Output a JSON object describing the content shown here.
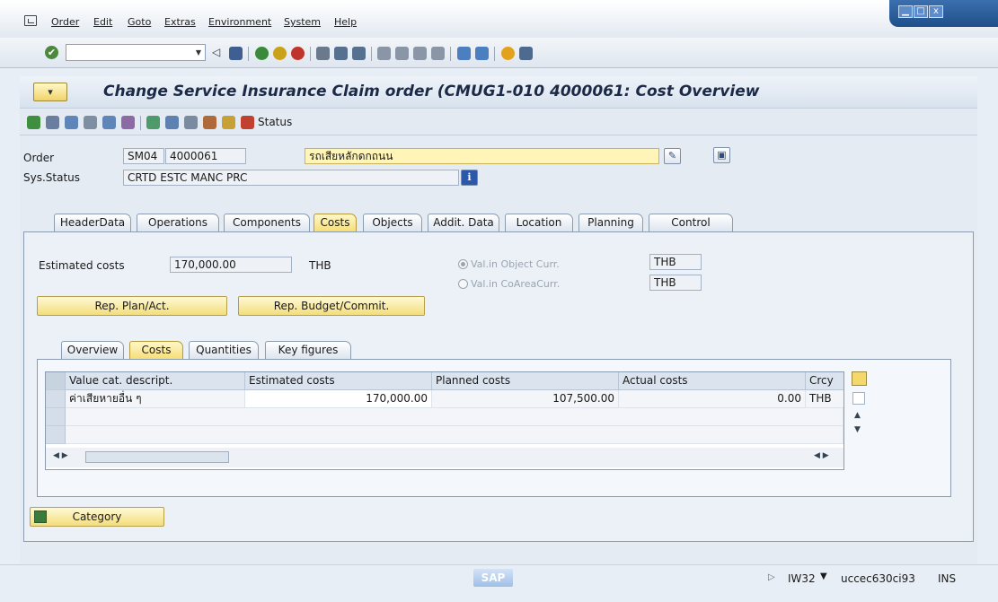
{
  "menu": {
    "items": [
      "Order",
      "Edit",
      "Goto",
      "Extras",
      "Environment",
      "System",
      "Help"
    ]
  },
  "window_controls": {
    "min": "▁",
    "max": "□",
    "close": "x"
  },
  "toolbar": {
    "command_value": ""
  },
  "title": "Change Service Insurance Claim order (CMUG1-010 4000061: Cost Overview",
  "app_toolbar": {
    "status_label": "Status"
  },
  "header": {
    "order_label": "Order",
    "order_type": "SM04",
    "order_number": "4000061",
    "order_description": "รถเสียหลักดกถนน",
    "sys_status_label": "Sys.Status",
    "sys_status_value": "CRTD ESTC MANC PRC"
  },
  "tabs": [
    "HeaderData",
    "Operations",
    "Components",
    "Costs",
    "Objects",
    "Addit. Data",
    "Location",
    "Planning",
    "Control"
  ],
  "active_tab": "Costs",
  "costs": {
    "estimated_label": "Estimated costs",
    "estimated_value": "170,000.00",
    "estimated_currency": "THB",
    "val_object_curr_label": "Val.in Object Curr.",
    "val_object_curr_value": "THB",
    "val_coarea_curr_label": "Val.in CoAreaCurr.",
    "val_coarea_curr_value": "THB",
    "btn_plan_act": "Rep. Plan/Act.",
    "btn_budget": "Rep. Budget/Commit."
  },
  "subtabs": [
    "Overview",
    "Costs",
    "Quantities",
    "Key figures"
  ],
  "active_subtab": "Costs",
  "table": {
    "headers": [
      "Value cat. descript.",
      "Estimated costs",
      "Planned costs",
      "Actual costs",
      "Crcy"
    ],
    "rows": [
      [
        "ค่าเสียหายอื่น ๆ",
        "170,000.00",
        "107,500.00",
        "0.00",
        "THB"
      ]
    ]
  },
  "category_button": "Category",
  "status_bar": {
    "transaction": "IW32",
    "server": "uccec630ci93",
    "mode": "INS",
    "sap_logo": "SAP"
  },
  "colors": {
    "accent_yellow": "#f6de7a",
    "title_text": "#1d2a47",
    "window_blue": "#1e4f8a"
  }
}
